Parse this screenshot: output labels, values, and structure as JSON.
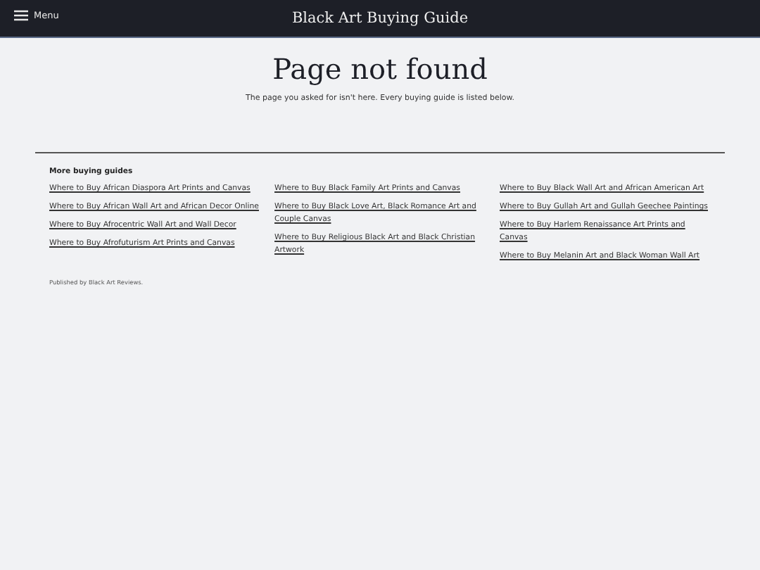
{
  "header": {
    "menu_label": "Menu",
    "site_title": "Black Art Buying Guide"
  },
  "main": {
    "title": "Page not found",
    "message": "The page you asked for isn't here. Every buying guide is listed below."
  },
  "guides": {
    "heading": "More buying guides",
    "columns": [
      [
        "Where to Buy African Diaspora Art Prints and Canvas",
        "Where to Buy African Wall Art and African Decor Online",
        "Where to Buy Afrocentric Wall Art and Wall Decor",
        "Where to Buy Afrofuturism Art Prints and Canvas"
      ],
      [
        "Where to Buy Black Family Art Prints and Canvas",
        "Where to Buy Black Love Art, Black Romance Art and Couple Canvas",
        "Where to Buy Religious Black Art and Black Christian Artwork"
      ],
      [
        "Where to Buy Black Wall Art and African American Art",
        "Where to Buy Gullah Art and Gullah Geechee Paintings",
        "Where to Buy Harlem Renaissance Art Prints and Canvas",
        "Where to Buy Melanin Art and Black Woman Wall Art"
      ]
    ]
  },
  "footer": {
    "text": "Published by Black Art Reviews."
  }
}
